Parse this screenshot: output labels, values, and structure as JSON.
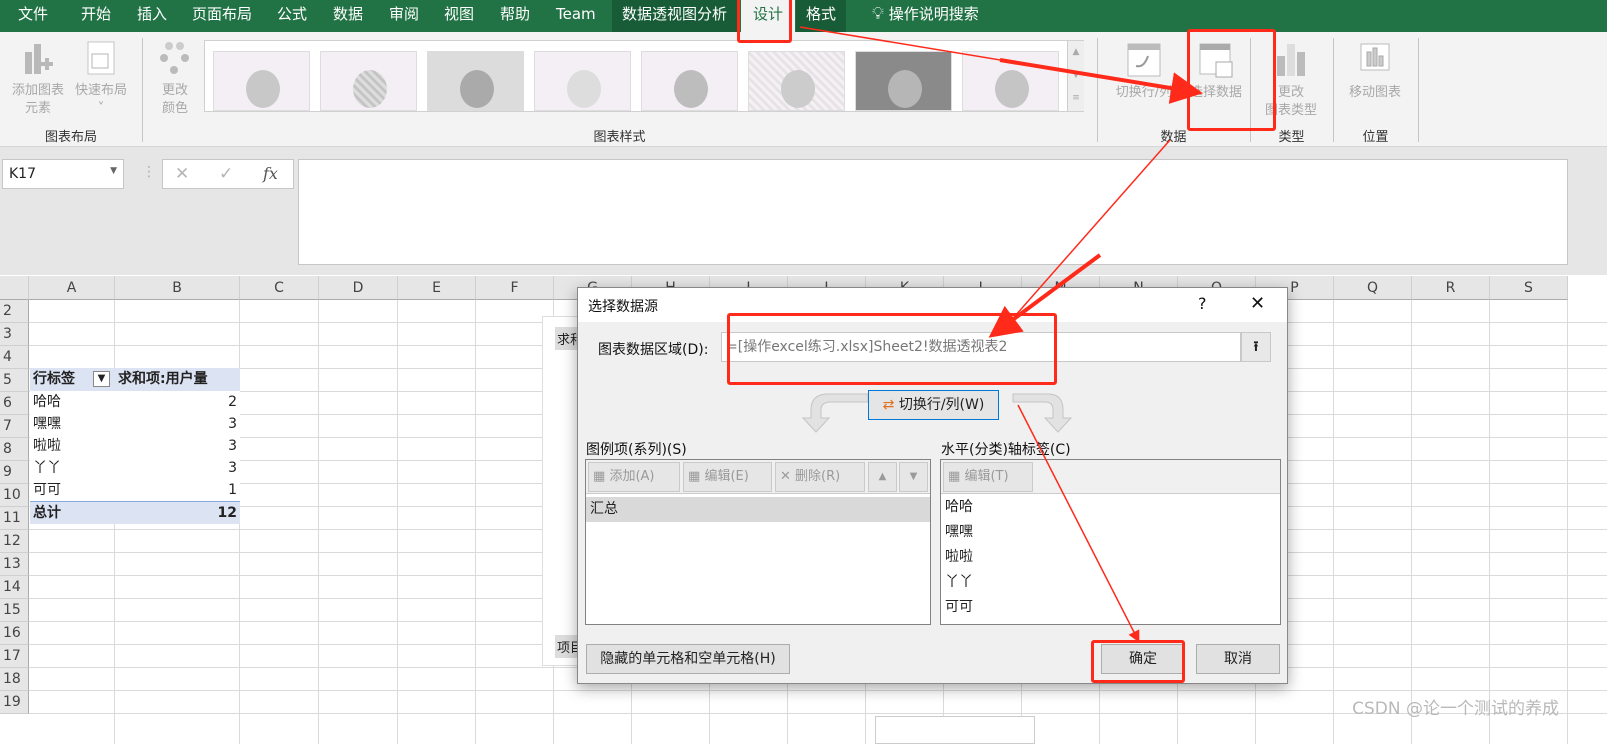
{
  "ribbon_tabs": [
    {
      "label": "文件"
    },
    {
      "label": "开始"
    },
    {
      "label": "插入"
    },
    {
      "label": "页面布局"
    },
    {
      "label": "公式"
    },
    {
      "label": "数据"
    },
    {
      "label": "审阅"
    },
    {
      "label": "视图"
    },
    {
      "label": "帮助"
    },
    {
      "label": "Team"
    },
    {
      "label": "数据透视图分析"
    },
    {
      "label": "设计"
    },
    {
      "label": "格式"
    }
  ],
  "tell_me": "操作说明搜索",
  "ribbon": {
    "add_chart_element": [
      "添加图表",
      "元素"
    ],
    "quick_layout": "快速布局",
    "change_colors": [
      "更改",
      "颜色"
    ],
    "group_chart_layouts": "图表布局",
    "group_chart_styles": "图表样式",
    "switch_row_col": "切换行/列",
    "select_data": "选择数据",
    "change_chart_type": [
      "更改",
      "图表类型"
    ],
    "move_chart": "移动图表",
    "group_data": "数据",
    "group_type": "类型",
    "group_location": "位置"
  },
  "formula_bar": {
    "name_box": "K17",
    "cancel": "✕",
    "enter": "✓",
    "fx": "fx",
    "value": ""
  },
  "sheet": {
    "columns": [
      "A",
      "B",
      "C",
      "D",
      "E",
      "F",
      "G",
      "H",
      "I",
      "J",
      "K",
      "L",
      "M",
      "N",
      "O",
      "P",
      "Q",
      "R",
      "S"
    ],
    "rows": [
      "2",
      "3",
      "4",
      "5",
      "6",
      "7",
      "8",
      "9",
      "10",
      "11",
      "12",
      "13",
      "14",
      "15",
      "16",
      "17",
      "18",
      "19"
    ],
    "pivot": {
      "header_label": "行标签",
      "header_value": "求和项:用户量",
      "items": [
        {
          "label": " 哈哈",
          "value": "2"
        },
        {
          "label": "嘿嘿",
          "value": "3"
        },
        {
          "label": "啦啦",
          "value": "3"
        },
        {
          "label": "丫丫",
          "value": "3"
        },
        {
          "label": "可可",
          "value": "1"
        }
      ],
      "total_label": "总计",
      "total_value": "12"
    },
    "chart_partial": {
      "top_label": "求和",
      "bottom_label": "项目"
    }
  },
  "dialog": {
    "title": "选择数据源",
    "help": "?",
    "close": "✕",
    "range_label": "图表数据区域(D):",
    "range_value": "=[操作excel练习.xlsx]Sheet2!数据透视表2",
    "switch_button": "切换行/列(W)",
    "series_label": "图例项(系列)(S)",
    "series_toolbar": {
      "add": "添加(A)",
      "edit": "编辑(E)",
      "remove": "删除(R)",
      "up": "▲",
      "down": "▼"
    },
    "series_items": [
      "汇总"
    ],
    "category_label": "水平(分类)轴标签(C)",
    "category_edit": "编辑(T)",
    "category_items": [
      "哈哈",
      "嘿嘿",
      "啦啦",
      "丫丫",
      "可可"
    ],
    "hidden_cells_button": "隐藏的单元格和空单元格(H)",
    "ok": "确定",
    "cancel": "取消"
  },
  "watermark": "CSDN @论一个测试的养成",
  "colors": {
    "excel_green": "#217346",
    "annotation_red": "#ff2a1a",
    "pivot_header": "#dce3f2"
  }
}
